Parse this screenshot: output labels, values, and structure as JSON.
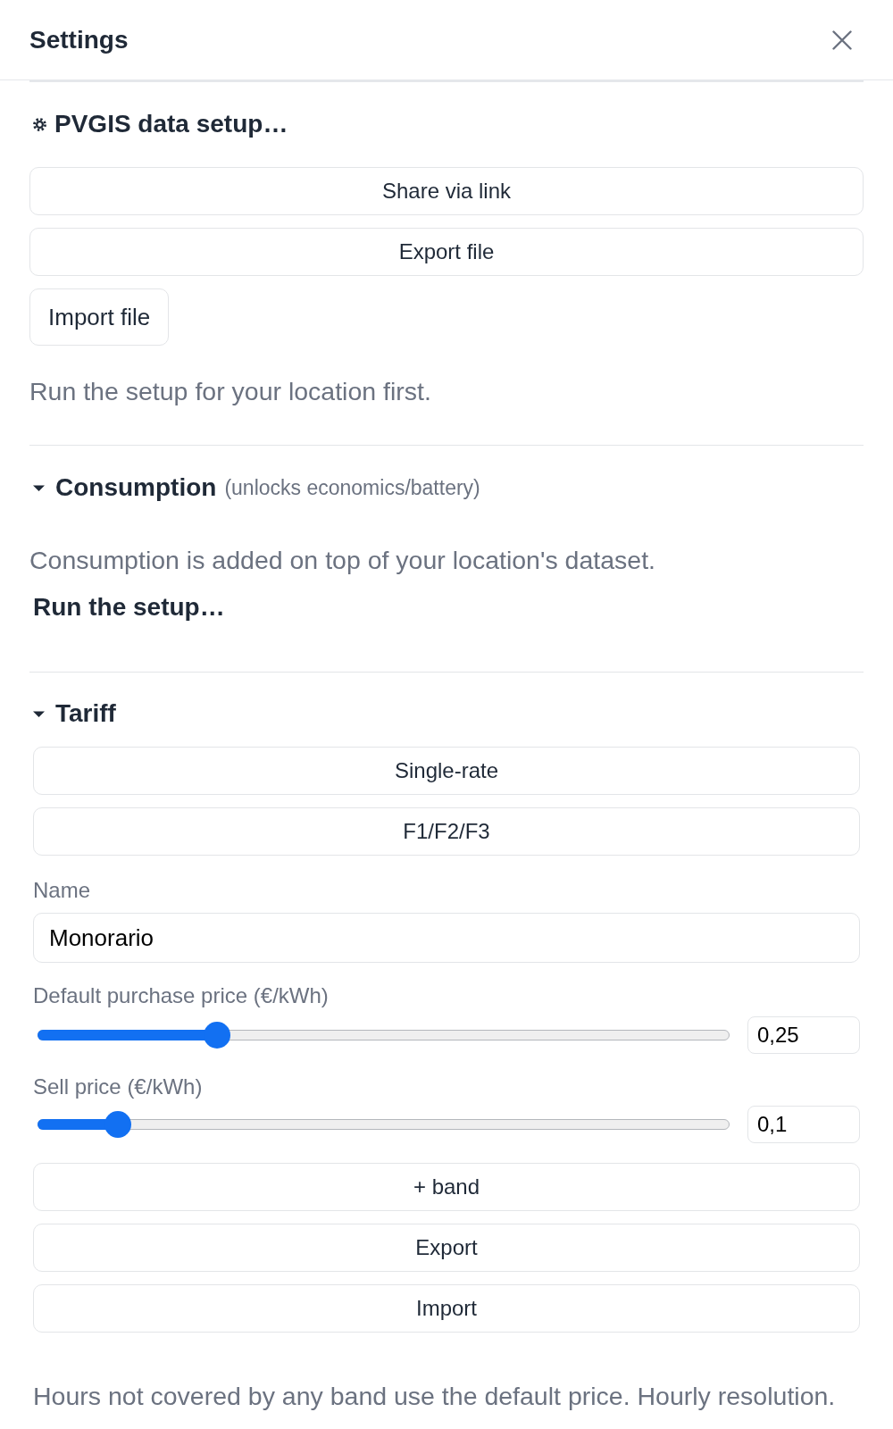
{
  "header": {
    "title": "Settings"
  },
  "pvgis": {
    "title": "PVGIS data setup…",
    "buttons": [
      {
        "label": "Share via link",
        "kind": "block"
      },
      {
        "label": "Export file",
        "kind": "block"
      },
      {
        "label": "Import file",
        "kind": "inline"
      }
    ],
    "note": "Run the setup for your location first."
  },
  "consumption": {
    "title": "Consumption",
    "subtitle": "(unlocks economics/battery)",
    "expanded": true,
    "note": "Consumption is added on top of your location's dataset.",
    "action": "Run the setup…"
  },
  "tariff": {
    "title": "Tariff",
    "expanded": true,
    "types": [
      {
        "label": "Single-rate"
      },
      {
        "label": "F1/F2/F3"
      }
    ],
    "name": {
      "label": "Name",
      "value": "Monorario"
    },
    "prices": [
      {
        "label": "Default purchase price (€/kWh)",
        "level": 0.25,
        "value": "0,25"
      },
      {
        "label": "Sell price (€/kWh)",
        "level": 0.1,
        "value": "0,1"
      }
    ],
    "buttons": [
      {
        "label": "+ band"
      },
      {
        "label": "Export"
      },
      {
        "label": "Import"
      }
    ],
    "note": "Hours not covered by any band use the default price. Hourly resolution."
  }
}
